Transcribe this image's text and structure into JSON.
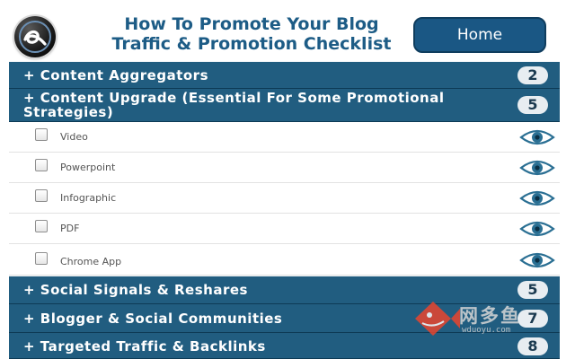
{
  "header": {
    "title_line1": "How To Promote Your Blog",
    "title_line2": "Traffic & Promotion Checklist",
    "home_label": "Home",
    "logo_icon": "alpha-logo-icon"
  },
  "colors": {
    "title": "#1d5c86",
    "home_button": "#1a5784",
    "section_bar": "#215d80",
    "badge_bg": "#e8edf1",
    "eye_icon": "#2a6f93"
  },
  "sections": [
    {
      "label": "+ Content Aggregators",
      "count": "2"
    },
    {
      "label": "+ Content Upgrade (Essential For Some Promotional Strategies)",
      "count": "5"
    },
    {
      "label": "+ Social Signals & Reshares",
      "count": "5"
    },
    {
      "label": "+ Blogger & Social Communities",
      "count": "7"
    },
    {
      "label": "+ Targeted Traffic & Backlinks",
      "count": "8"
    }
  ],
  "items": [
    {
      "label": "Video",
      "checked": false,
      "action_icon": "eye-icon"
    },
    {
      "label": "Powerpoint",
      "checked": false,
      "action_icon": "eye-icon"
    },
    {
      "label": "Infographic",
      "checked": false,
      "action_icon": "eye-icon"
    },
    {
      "label": "PDF",
      "checked": false,
      "action_icon": "eye-icon"
    },
    {
      "label": "Chrome App",
      "checked": false,
      "action_icon": "eye-icon"
    }
  ],
  "watermark": {
    "text": "网多鱼",
    "subtext": "wduoyu.com",
    "icon": "fish-logo-icon"
  }
}
